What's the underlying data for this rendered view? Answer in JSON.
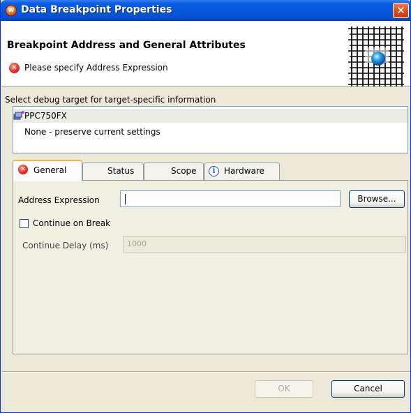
{
  "window": {
    "title": "Data Breakpoint Properties",
    "close_icon": "close-icon",
    "app_icon_letter": "W"
  },
  "header": {
    "title": "Breakpoint Address and General Attributes",
    "message": "Please specify Address Expression",
    "message_icon": "error-icon",
    "error_glyph": "✕"
  },
  "target": {
    "label": "Select debug target for target-specific information",
    "items": [
      {
        "label": "PPC750FX",
        "selected": true
      },
      {
        "label": "None - preserve current settings",
        "selected": false
      }
    ]
  },
  "tabs": [
    {
      "label": "General",
      "icon": "error-icon",
      "active": true
    },
    {
      "label": "Status",
      "icon": "",
      "active": false
    },
    {
      "label": "Scope",
      "icon": "",
      "active": false
    },
    {
      "label": "Hardware",
      "icon": "info-icon",
      "active": false
    }
  ],
  "info_glyph": "i",
  "general": {
    "address_label": "Address Expression",
    "address_value": "",
    "browse_label": "Browse...",
    "continue_label": "Continue on Break",
    "continue_checked": false,
    "delay_label": "Continue Delay (ms)",
    "delay_value": "1000"
  },
  "footer": {
    "ok_label": "OK",
    "cancel_label": "Cancel"
  },
  "colors": {
    "titlebar": "#0756dc",
    "active_tab_accent": "#f7b63e",
    "error_red": "#e0301e"
  }
}
